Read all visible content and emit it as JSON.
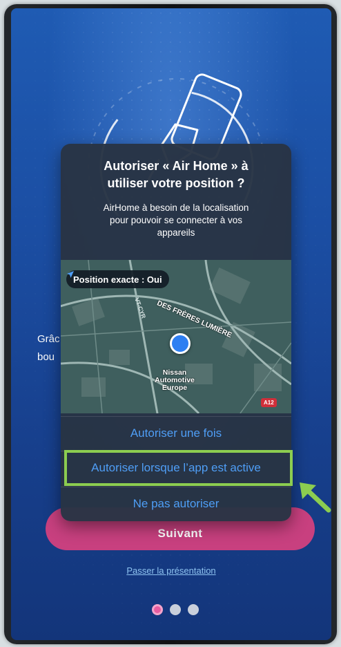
{
  "app": {
    "intro_text": "Grâc\nbou",
    "next_button_label": "Suivant",
    "skip_link": "Passer la présentation",
    "page_count": 3,
    "active_page": 1
  },
  "dialog": {
    "title": "Autoriser « Air Home » à\nutiliser votre position ?",
    "message": "AirHome à besoin de la localisation\npour pouvoir se connecter à vos\nappareils",
    "precise_location_label": "Position exacte : Oui",
    "map": {
      "street_label": "DES FRÈRES LUMIÈRE",
      "street_label_2": "VT-CYR",
      "poi_label": "Nissan\nAutomotive\nEurope",
      "road_badge": "A12"
    },
    "options": {
      "allow_once": "Autoriser une fois",
      "allow_while_using": "Autoriser lorsque l’app est active",
      "dont_allow": "Ne pas autoriser"
    }
  },
  "colors": {
    "app_background": "#1b4ea3",
    "accent_button": "#c8407f",
    "dialog_option_text": "#4f9ef6",
    "highlight": "#8ccd50"
  },
  "icons": {
    "hero": "phone-in-hand-icon",
    "precise_location": "location-arrow-icon",
    "annotation": "green-arrow-icon"
  }
}
